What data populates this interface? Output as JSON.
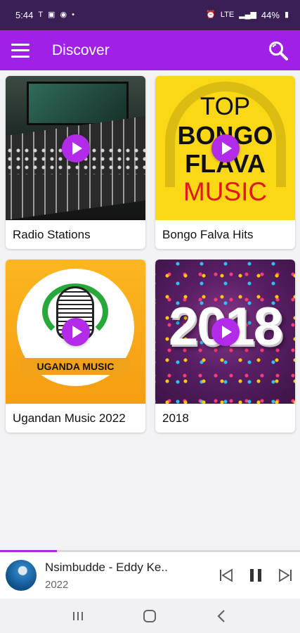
{
  "status": {
    "time": "5:44",
    "battery": "44%",
    "network": "LTE"
  },
  "app_bar": {
    "title": "Discover",
    "menu_icon": "hamburger-menu-icon",
    "search_icon": "search-icon"
  },
  "cards": [
    {
      "label": "Radio Stations"
    },
    {
      "label": "Bongo Falva Hits",
      "art_lines": [
        "TOP",
        "BONGO",
        "FLAVA",
        "MUSIC"
      ]
    },
    {
      "label": "Ugandan Music 2022",
      "art_text": "UGANDA MUSIC"
    },
    {
      "label": "2018",
      "art_text": "2018"
    }
  ],
  "player": {
    "title": "Nsimbudde - Eddy Ke..",
    "subtitle": "2022",
    "progress": 0.19
  },
  "colors": {
    "accent": "#a020e6",
    "status_bar": "#3a1f55",
    "play_button": "#b12be8"
  }
}
